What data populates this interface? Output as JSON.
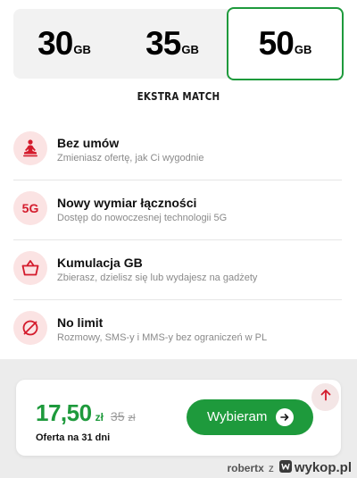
{
  "plans": [
    {
      "value": "30",
      "unit": "GB",
      "selected": false
    },
    {
      "value": "35",
      "unit": "GB",
      "selected": false
    },
    {
      "value": "50",
      "unit": "GB",
      "selected": true
    }
  ],
  "plan_name": "EKSTRA MATCH",
  "features": [
    {
      "icon": "meditation-person-icon",
      "title": "Bez umów",
      "desc": "Zmieniasz ofertę, jak Ci wygodnie"
    },
    {
      "icon": "5g-icon",
      "icon_text": "5G",
      "title": "Nowy wymiar łączności",
      "desc": "Dostęp do nowoczesnej technologii 5G"
    },
    {
      "icon": "basket-icon",
      "title": "Kumulacja GB",
      "desc": "Zbierasz, dzielisz się lub wydajesz na gadżety"
    },
    {
      "icon": "no-limit-icon",
      "title": "No limit",
      "desc": "Rozmowy, SMS-y i MMS-y bez ograniczeń w PL"
    }
  ],
  "offer": {
    "price": "17,50",
    "currency": "zł",
    "old_price": "35",
    "old_currency": "zł",
    "duration": "Oferta na 31 dni",
    "button_label": "Wybieram"
  },
  "watermark": {
    "author": "robertx",
    "connector": "z",
    "site": "wykop.pl"
  },
  "colors": {
    "accent_green": "#1e9a3c",
    "accent_red": "#d41b2c",
    "icon_bg": "#fbe3e3"
  }
}
